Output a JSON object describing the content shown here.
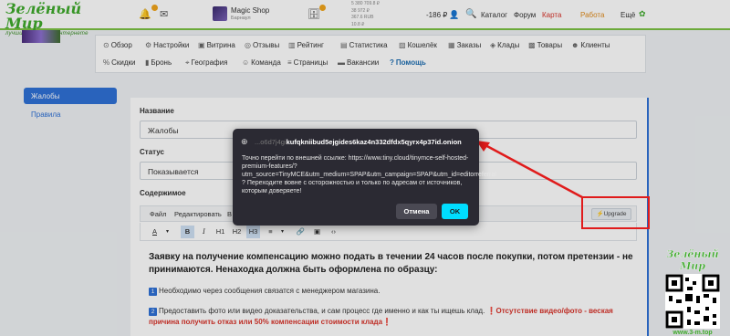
{
  "header": {
    "logo_title": "Зелёный Мир",
    "logo_slogan": "лучший магазин в интернете",
    "shop_name": "Magic Shop",
    "shop_sub": "Барнаул",
    "rates": [
      "5 380 709.8 ₽",
      "38 972 ₽",
      "367.6 RUB",
      "10.8 ₽"
    ],
    "balance": "-186 ₽",
    "links": [
      "Каталог",
      "Форум",
      "Карта",
      "Работа",
      "Ещё"
    ]
  },
  "menu": {
    "row1": [
      "Обзор",
      "Настройки",
      "Витрина",
      "Отзывы",
      "Рейтинг",
      "Статистика",
      "Кошелёк",
      "Заказы",
      "Клады",
      "Товары",
      "Клиенты"
    ],
    "row2": [
      "Скидки",
      "Бронь",
      "География",
      "Команда",
      "Страницы",
      "Вакансии",
      "Помощь"
    ]
  },
  "sidebar": {
    "items": [
      "Жалобы",
      "Правила"
    ]
  },
  "form": {
    "name_label": "Название",
    "name_value": "Жалобы",
    "status_label": "Статус",
    "status_value": "Показывается",
    "content_label": "Содержимое",
    "editor_menus": [
      "Файл",
      "Редактировать",
      "В"
    ],
    "editor_tools": [
      "A",
      "B",
      "I",
      "H1",
      "H2",
      "H3"
    ],
    "upgrade_label": "⚡Upgrade",
    "content": {
      "heading": "Заявку на получение компенсацию можно подать в течении 24 часов после покупки, потом претензии - не принимаются. Ненаходка должна быть оформлена по образцу:",
      "item1_num": "1",
      "item1_text": "Необходимо через сообщения связатся с менеджером магазина.",
      "item2_num": "2",
      "item2_text": "Предоставить фото или видео доказательства, и сам процесс где именно и как ты ищешь клад.",
      "item2_warn": "❗Отсутствие видео/фото - веская причина получить отказ или 50% компенсации стоимости клада❗"
    }
  },
  "dialog": {
    "title_dim": "...o6d7j4gi",
    "title_main": "kufqkniibud5ejgides6kaz4n332dfdx5qyrx4p37id.onion",
    "body": "Точно перейти по внешней ссылке: https://www.tiny.cloud/tinymce-self-hosted-premium-features/?utm_source=TinyMCE&utm_medium=SPAP&utm_campaign=SPAP&utm_id=editorreferral ? Переходите вовне с осторожностью и только по адресам от источников, которым доверяете!",
    "cancel_label": "Отмена",
    "ok_label": "OK"
  },
  "watermark": {
    "title": "Зелёный Мир",
    "url": "www.3-m.top"
  },
  "colors": {
    "brand_green": "#3faa2c",
    "accent_blue": "#2f71d6",
    "dialog_bg": "#2b2a33",
    "ok_button": "#00ddff",
    "annotation_red": "#e01b1b"
  }
}
